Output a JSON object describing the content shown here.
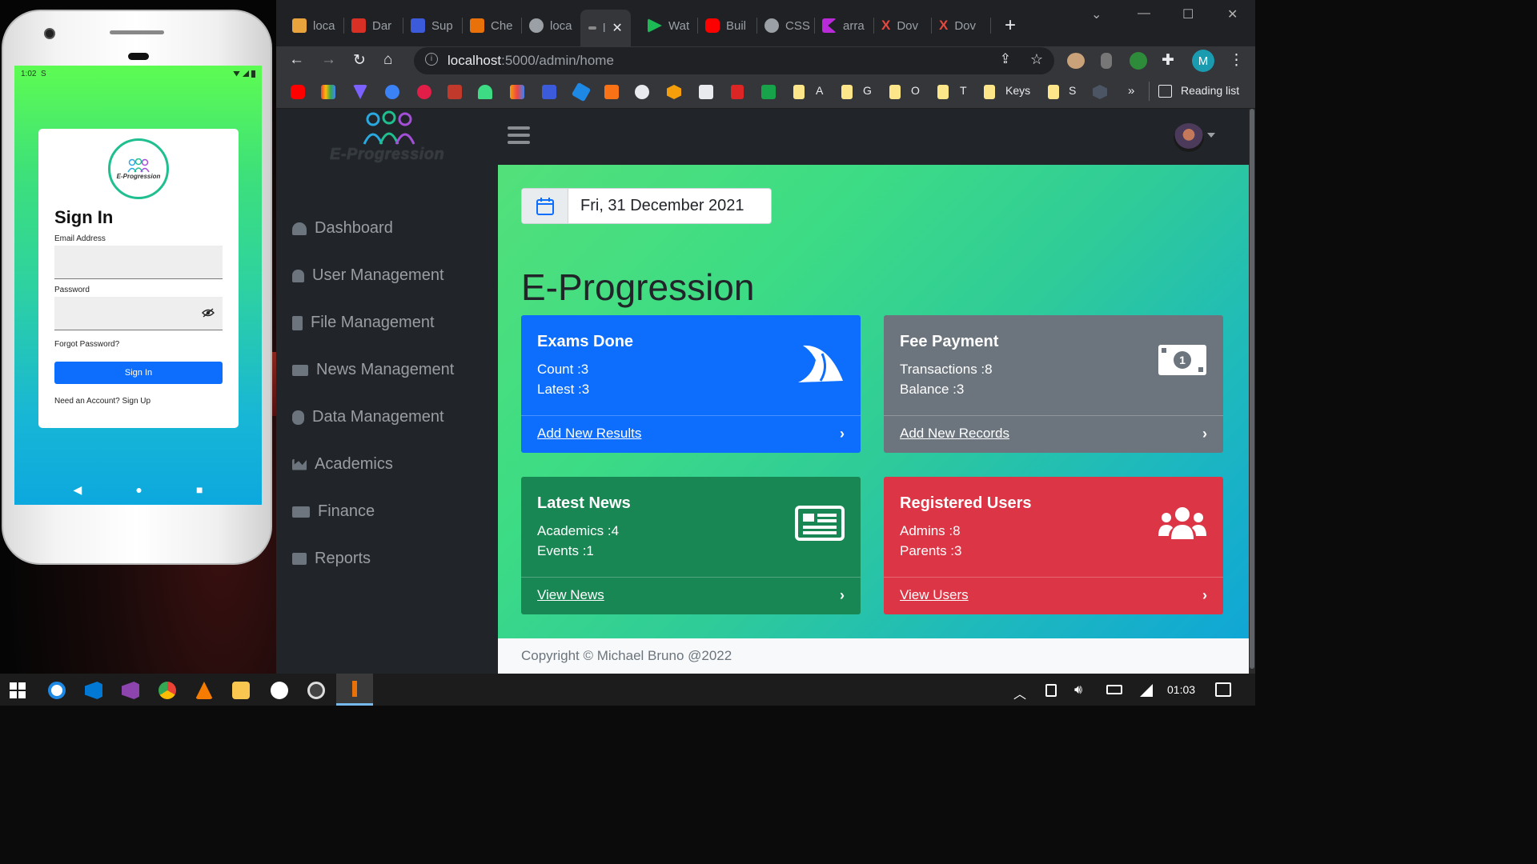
{
  "phone": {
    "status_time": "1:02",
    "status_extra": "S",
    "logo_text": "E-Progression",
    "heading": "Sign In",
    "email_label": "Email Address",
    "password_label": "Password",
    "forgot": "Forgot Password?",
    "signin_button": "Sign In",
    "signup": "Need an Account? Sign Up",
    "nav_back": "◀",
    "nav_home": "●",
    "nav_recent": "■"
  },
  "browser": {
    "tabs": [
      {
        "label": "loca",
        "icon_color": "#e8a33d"
      },
      {
        "label": "Dar",
        "icon_color": "#d93025"
      },
      {
        "label": "Sup",
        "icon_color": "#3b5bdb"
      },
      {
        "label": "Che",
        "icon_color": "#e8710a"
      },
      {
        "label": "loca",
        "icon_color": "#9aa0a6"
      },
      {
        "label": "l",
        "icon_color": "#888888"
      },
      {
        "label": "Wat",
        "icon_color": "#1db954"
      },
      {
        "label": "Buil",
        "icon_color": "#ff0000"
      },
      {
        "label": "CSS",
        "icon_color": "#9aa0a6"
      },
      {
        "label": "arra",
        "icon_color": "#b92bd9"
      },
      {
        "label": "Dov",
        "icon_color": "#e8473d"
      },
      {
        "label": "Dov",
        "icon_color": "#e8473d"
      }
    ],
    "new_tab": "+",
    "close_tab": "✕",
    "url_host": "localhost",
    "url_path": ":5000/admin/home",
    "profile_letter": "M",
    "bookmarks_text": [
      "A",
      "G",
      "O",
      "T",
      "Keys",
      "S"
    ],
    "more": "»",
    "reading_list": "Reading list"
  },
  "app": {
    "brand": "E-Progression",
    "sidebar": [
      {
        "label": "Dashboard",
        "icon": "dashboard-icon"
      },
      {
        "label": "User Management",
        "icon": "user-icon"
      },
      {
        "label": "File Management",
        "icon": "file-icon"
      },
      {
        "label": "News Management",
        "icon": "news-icon"
      },
      {
        "label": "Data Management",
        "icon": "database-icon"
      },
      {
        "label": "Academics",
        "icon": "chart-icon"
      },
      {
        "label": "Finance",
        "icon": "money-icon"
      },
      {
        "label": "Reports",
        "icon": "table-icon"
      }
    ],
    "date": "Fri, 31 December 2021",
    "page_title": "E-Progression",
    "cards": {
      "exams": {
        "title": "Exams Done",
        "line1": "Count :3",
        "line2": "Latest :3",
        "link": "Add New Results",
        "color": "#0d6efd"
      },
      "fee": {
        "title": "Fee Payment",
        "line1": "Transactions :8",
        "line2": "Balance :3",
        "link": "Add New Records",
        "color": "#6c757d"
      },
      "news": {
        "title": "Latest News",
        "line1": "Academics :4",
        "line2": "Events :1",
        "link": "View News",
        "color": "#198754"
      },
      "users": {
        "title": "Registered Users",
        "line1": "Admins :8",
        "line2": "Parents :3",
        "link": "View Users",
        "color": "#dc3545"
      }
    },
    "footer": "Copyright © Michael Bruno @2022"
  },
  "taskbar": {
    "time": "01:03"
  }
}
